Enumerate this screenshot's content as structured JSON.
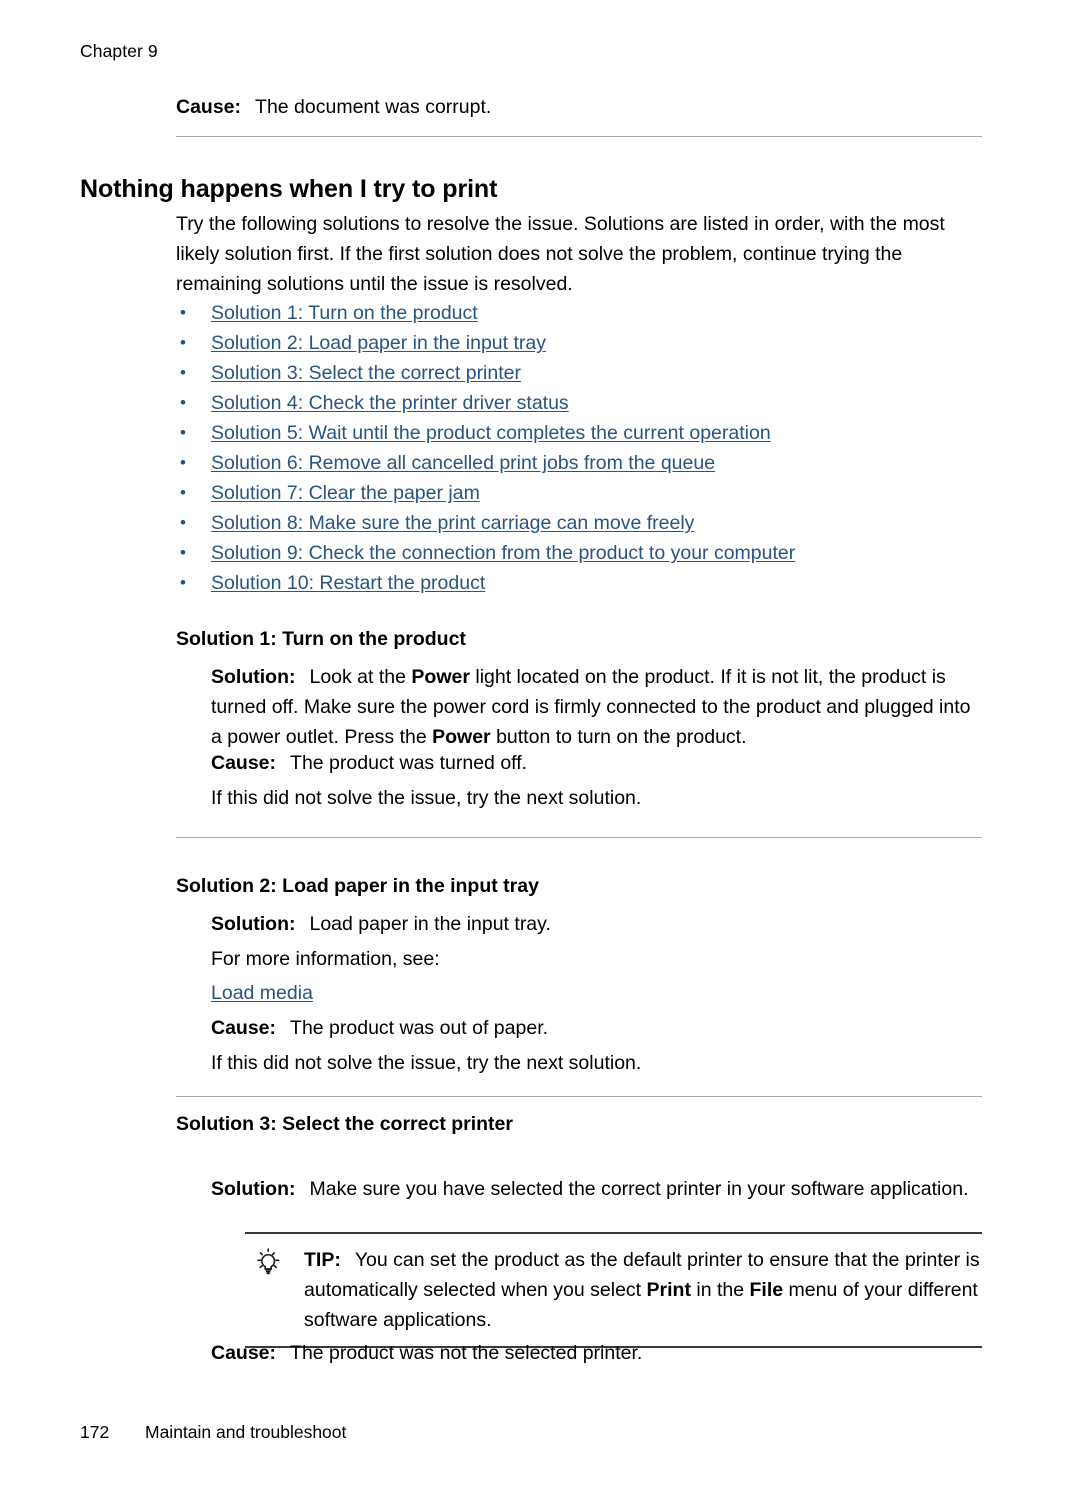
{
  "header": {
    "chapter": "Chapter 9"
  },
  "top_cause": {
    "label": "Cause:",
    "text": "The document was corrupt."
  },
  "section": {
    "title": "Nothing happens when I try to print",
    "intro": "Try the following solutions to resolve the issue. Solutions are listed in order, with the most likely solution first. If the first solution does not solve the problem, continue trying the remaining solutions until the issue is resolved."
  },
  "solution_links": [
    {
      "label": "Solution 1: Turn on the product"
    },
    {
      "label": "Solution 2: Load paper in the input tray"
    },
    {
      "label": "Solution 3: Select the correct printer"
    },
    {
      "label": "Solution 4: Check the printer driver status"
    },
    {
      "label": "Solution 5: Wait until the product completes the current operation"
    },
    {
      "label": "Solution 6: Remove all cancelled print jobs from the queue"
    },
    {
      "label": "Solution 7: Clear the paper jam"
    },
    {
      "label": "Solution 8: Make sure the print carriage can move freely"
    },
    {
      "label": "Solution 9: Check the connection from the product to your computer"
    },
    {
      "label": "Solution 10: Restart the product"
    }
  ],
  "bullet_glyph": "•",
  "solution1": {
    "heading": "Solution 1: Turn on the product",
    "solution_label": "Solution:",
    "solution_text_1": "Look at the ",
    "solution_bold_1": "Power",
    "solution_text_2": " light located on the product. If it is not lit, the product is turned off. Make sure the power cord is firmly connected to the product and plugged into a power outlet. Press the ",
    "solution_bold_2": "Power",
    "solution_text_3": " button to turn on the product.",
    "cause_label": "Cause:",
    "cause_text": "The product was turned off.",
    "next": "If this did not solve the issue, try the next solution."
  },
  "solution2": {
    "heading": "Solution 2: Load paper in the input tray",
    "solution_label": "Solution:",
    "solution_text": "Load paper in the input tray.",
    "more_info": "For more information, see:",
    "link": "Load media",
    "cause_label": "Cause:",
    "cause_text": "The product was out of paper.",
    "next": "If this did not solve the issue, try the next solution."
  },
  "solution3": {
    "heading": "Solution 3: Select the correct printer",
    "solution_label": "Solution:",
    "solution_text": "Make sure you have selected the correct printer in your software application.",
    "tip_label": "TIP:",
    "tip_text_1": "You can set the product as the default printer to ensure that the printer is automatically selected when you select ",
    "tip_bold_1": "Print",
    "tip_text_2": " in the ",
    "tip_bold_2": "File",
    "tip_text_3": " menu of your different software applications.",
    "cause_label": "Cause:",
    "cause_text": "The product was not the selected printer."
  },
  "footer": {
    "page_number": "172",
    "title": "Maintain and troubleshoot"
  },
  "colors": {
    "link": "#2a5480",
    "rule_light": "#a9a9ad",
    "rule_dark": "#3a3a3a",
    "text": "#000000"
  }
}
